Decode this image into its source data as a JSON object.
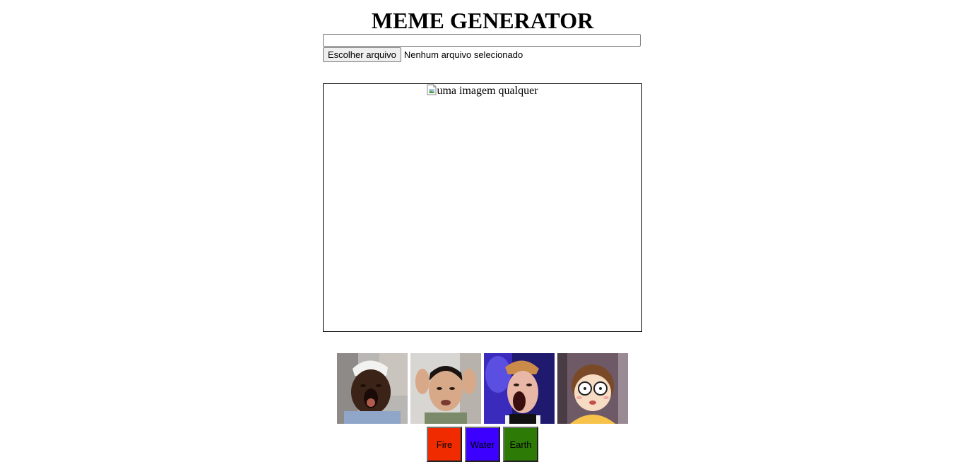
{
  "header": {
    "title": "MEME GENERATOR"
  },
  "text_input": {
    "value": "",
    "placeholder": ""
  },
  "file_input": {
    "button_label": "Escolher arquivo",
    "status": "Nenhum arquivo selecionado"
  },
  "meme": {
    "image_alt": "uma imagem qualquer"
  },
  "presets": [
    {
      "name": "preset-meme-1",
      "icon": "surprised-man-icon"
    },
    {
      "name": "preset-meme-2",
      "icon": "confused-man-icon"
    },
    {
      "name": "preset-meme-3",
      "icon": "shocked-man-icon"
    },
    {
      "name": "preset-meme-4",
      "icon": "cartoon-boy-icon"
    }
  ],
  "border_buttons": [
    {
      "label": "Fire",
      "color": "#f02b00"
    },
    {
      "label": "Water",
      "color": "#3b00ff"
    },
    {
      "label": "Earth",
      "color": "#2d7a06"
    }
  ]
}
